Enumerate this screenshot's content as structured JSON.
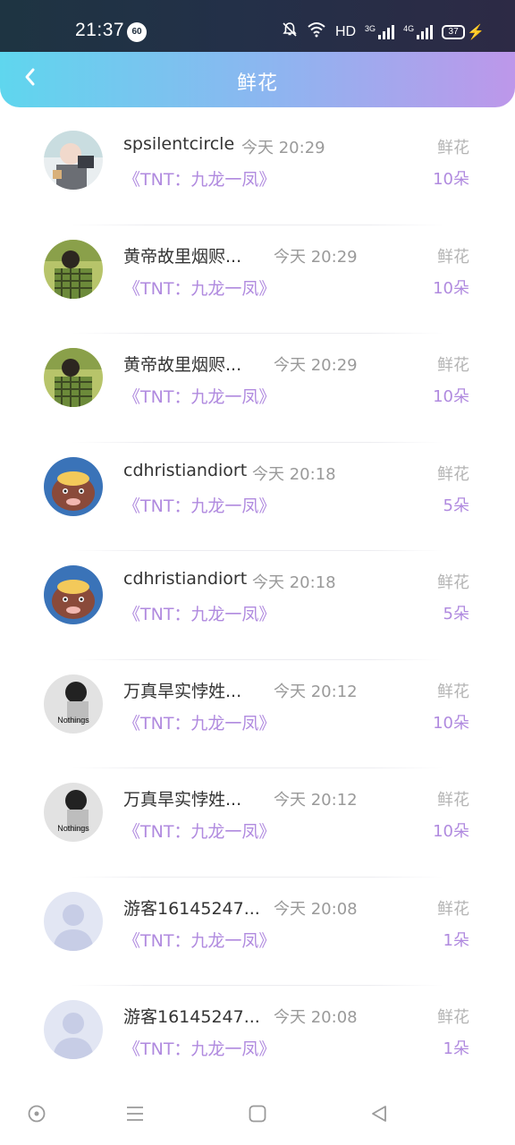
{
  "status_bar": {
    "time": "21:37",
    "notification_badge": "60",
    "network_label": "HD",
    "signal1_label": "3G",
    "signal2_label": "4G",
    "battery": "37"
  },
  "header": {
    "title": "鲜花",
    "back_icon": "chevron-left-icon",
    "gradient_colors": [
      "#5fd6ee",
      "#bd97ea"
    ]
  },
  "records": [
    {
      "avatar": "photo-avatar",
      "name": "spsilentcircle",
      "time": "今天 20:29",
      "gift": "鲜花",
      "work": "《TNT：九龙一凤》",
      "quantity": "10朵"
    },
    {
      "avatar": "plaid-shirt-avatar",
      "name": "黄帝故里烟赆...",
      "time": "今天 20:29",
      "gift": "鲜花",
      "work": "《TNT：九龙一凤》",
      "quantity": "10朵"
    },
    {
      "avatar": "plaid-shirt-avatar",
      "name": "黄帝故里烟赆...",
      "time": "今天 20:29",
      "gift": "鲜花",
      "work": "《TNT：九龙一凤》",
      "quantity": "10朵"
    },
    {
      "avatar": "cartoon-creature-avatar",
      "name": "cdhristiandiort",
      "time": "今天 20:18",
      "gift": "鲜花",
      "work": "《TNT：九龙一凤》",
      "quantity": "5朵"
    },
    {
      "avatar": "cartoon-creature-avatar",
      "name": "cdhristiandiort",
      "time": "今天 20:18",
      "gift": "鲜花",
      "work": "《TNT：九龙一凤》",
      "quantity": "5朵"
    },
    {
      "avatar": "nothings-avatar",
      "avatar_text": "Nothings",
      "name": "万真旱实悖姓...",
      "time": "今天 20:12",
      "gift": "鲜花",
      "work": "《TNT：九龙一凤》",
      "quantity": "10朵"
    },
    {
      "avatar": "nothings-avatar",
      "avatar_text": "Nothings",
      "name": "万真旱实悖姓...",
      "time": "今天 20:12",
      "gift": "鲜花",
      "work": "《TNT：九龙一凤》",
      "quantity": "10朵"
    },
    {
      "avatar": "default-user-avatar",
      "name": "游客16145247...",
      "time": "今天 20:08",
      "gift": "鲜花",
      "work": "《TNT：九龙一凤》",
      "quantity": "1朵"
    },
    {
      "avatar": "default-user-avatar",
      "name": "游客16145247...",
      "time": "今天 20:08",
      "gift": "鲜花",
      "work": "《TNT：九龙一凤》",
      "quantity": "1朵"
    }
  ],
  "bottom_nav": {
    "icons": [
      "circle-dot-icon",
      "menu-icon",
      "home-square-icon",
      "back-triangle-icon"
    ]
  },
  "colors": {
    "accent_purple": "#b08adf",
    "name_text": "#333333",
    "muted_text": "#9a9a9a"
  }
}
